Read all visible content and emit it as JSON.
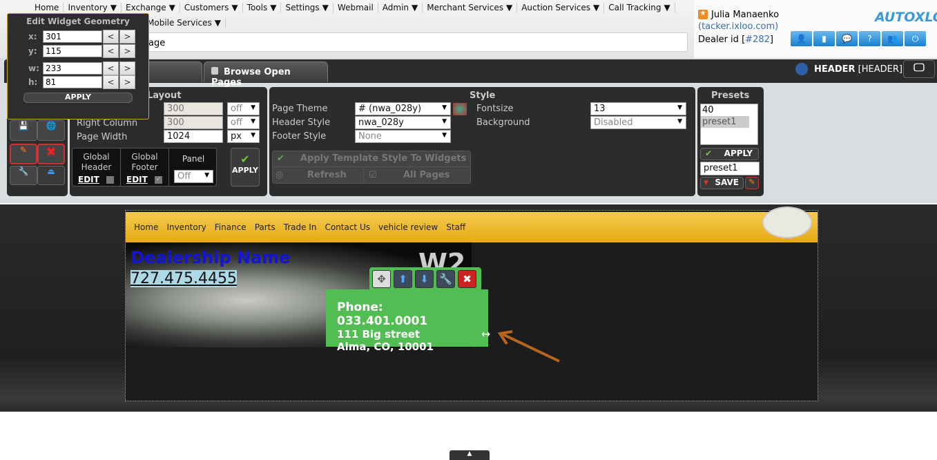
{
  "top_menu": {
    "row1": [
      "Home",
      "Inventory",
      "Exchange",
      "Customers",
      "Tools",
      "Settings",
      "Webmail",
      "Admin",
      "Merchant Services",
      "Auction Services",
      "Call Tracking"
    ],
    "row1_dropdown": [
      false,
      true,
      true,
      true,
      true,
      true,
      false,
      true,
      true,
      true,
      true
    ],
    "row2": [
      "Mobile Services"
    ],
    "url_text": "age"
  },
  "user": {
    "name": "Julia Manaenko",
    "domain": "(tacker.ixloo.com)",
    "dealer_label": "Dealer id",
    "dealer_id": "#282",
    "logo": "AUTOXLOO",
    "icons": [
      "user-icon",
      "stats-icon",
      "chat-icon",
      "help-icon",
      "users-icon",
      "power-icon"
    ]
  },
  "geometry": {
    "title": "Edit Widget Geometry",
    "fields": [
      {
        "label": "x:",
        "value": "301"
      },
      {
        "label": "y:",
        "value": "115"
      },
      {
        "label": "w:",
        "value": "233"
      },
      {
        "label": "h:",
        "value": "81"
      }
    ],
    "dec": "<",
    "inc": ">",
    "apply": "APPLY"
  },
  "tabs": {
    "browse": "Browse Open Pages",
    "current_name": "HEADER",
    "current_type": "[HEADER]"
  },
  "layout": {
    "title": "Layout",
    "rows": [
      {
        "label": "",
        "value": "300",
        "unit": "off"
      },
      {
        "label": "Right Column",
        "value": "300",
        "unit": "off"
      },
      {
        "label": "Page Width",
        "value": "1024",
        "unit": "px"
      }
    ],
    "global_header": "Global Header",
    "global_footer": "Global Footer",
    "edit": "EDIT",
    "panel_label": "Panel",
    "panel_value": "Off",
    "apply": "APPLY"
  },
  "style": {
    "title": "Style",
    "page_theme_label": "Page Theme",
    "page_theme": "# (nwa_028y)",
    "header_style_label": "Header Style",
    "header_style": "nwa_028y",
    "footer_style_label": "Footer Style",
    "footer_style": "None",
    "fontsize_label": "Fontsize",
    "fontsize": "13",
    "background_label": "Background",
    "background": "Disabled",
    "apply_template": "Apply Template Style To Widgets",
    "refresh": "Refresh",
    "all_pages": "All Pages"
  },
  "presets": {
    "title": "Presets",
    "items": [
      "40",
      "preset1"
    ],
    "selected": "preset1",
    "apply": "APPLY",
    "name_value": "preset1",
    "save": "SAVE"
  },
  "site": {
    "nav": [
      "Home",
      "Inventory",
      "Finance",
      "Parts",
      "Trade In",
      "Contact Us",
      "vehicle review",
      "Staff"
    ],
    "dealer_name": "Dealership Name",
    "phone": "727.475.4455",
    "hero_text": "W2"
  },
  "widget": {
    "phone": "Phone: 033.401.0001",
    "street": "111 Big street",
    "city": "Alma, CO, 10001",
    "color": "#52bd52"
  }
}
